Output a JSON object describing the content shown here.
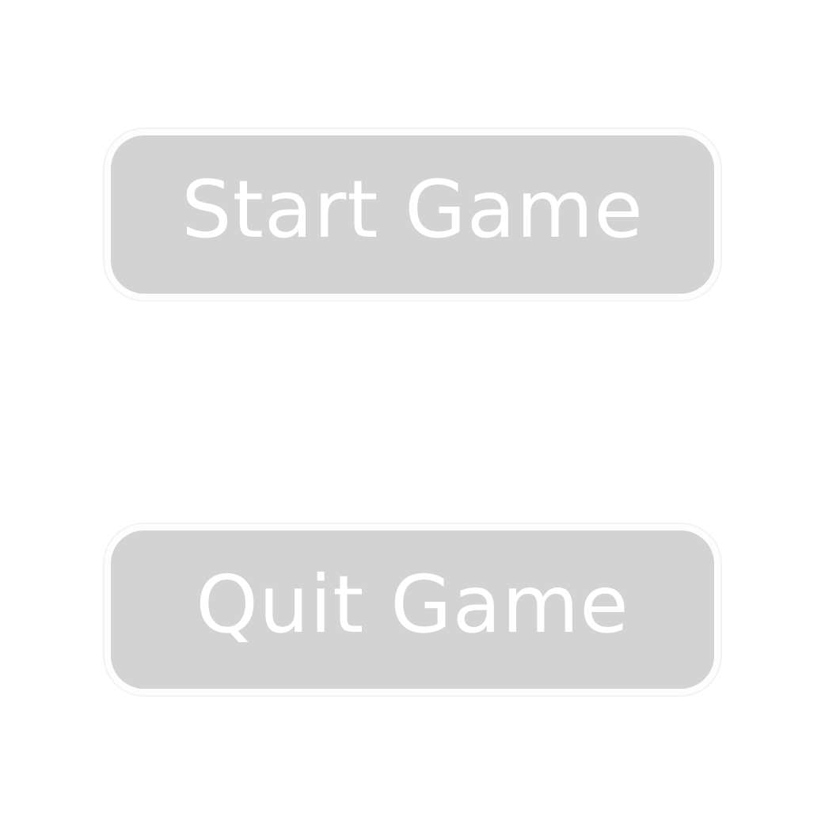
{
  "menu": {
    "buttons": [
      {
        "id": "start",
        "label": "Start Game"
      },
      {
        "id": "quit",
        "label": "Quit Game"
      }
    ]
  },
  "colors": {
    "background": "#ffffff",
    "button_fill": "#d3d3d3",
    "button_text": "#ffffff"
  }
}
